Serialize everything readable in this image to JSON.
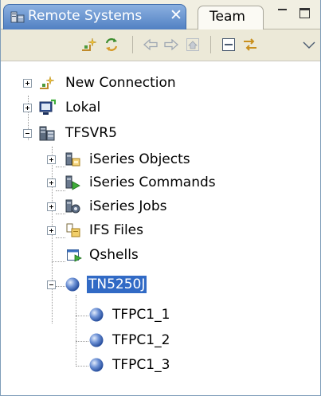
{
  "tabs": {
    "active_label": "Remote Systems",
    "active_icon": "remote-systems-icon",
    "close_glyph": "✕",
    "inactive_label": "Team"
  },
  "window_controls": [
    "minimize-icon",
    "maximize-icon"
  ],
  "toolbar": {
    "buttons": [
      "new-connection-icon",
      "refresh-icon",
      "back-icon",
      "forward-icon",
      "home-icon",
      "collapse-all-icon",
      "link-with-editor-icon",
      "view-menu-icon"
    ]
  },
  "tree": {
    "nodes": [
      {
        "label": "New Connection",
        "icon": "new-connection-icon"
      },
      {
        "label": "Lokal",
        "icon": "local-system-icon"
      },
      {
        "label": "TFSVR5",
        "icon": "server-icon"
      },
      {
        "label": "iSeries Objects",
        "icon": "iseries-objects-icon"
      },
      {
        "label": "iSeries Commands",
        "icon": "iseries-commands-icon"
      },
      {
        "label": "iSeries Jobs",
        "icon": "iseries-jobs-icon"
      },
      {
        "label": "IFS Files",
        "icon": "ifs-files-icon"
      },
      {
        "label": "Qshells",
        "icon": "qshells-icon"
      },
      {
        "label": "TN5250J",
        "icon": "session-ball-icon"
      },
      {
        "label": "TFPC1_1",
        "icon": "session-ball-icon"
      },
      {
        "label": "TFPC1_2",
        "icon": "session-ball-icon"
      },
      {
        "label": "TFPC1_3",
        "icon": "session-ball-icon"
      }
    ]
  },
  "colors": {
    "active_tab": "#4f7fc2",
    "selection": "#316ac5",
    "toolbar_bg": "#ece9d8"
  }
}
